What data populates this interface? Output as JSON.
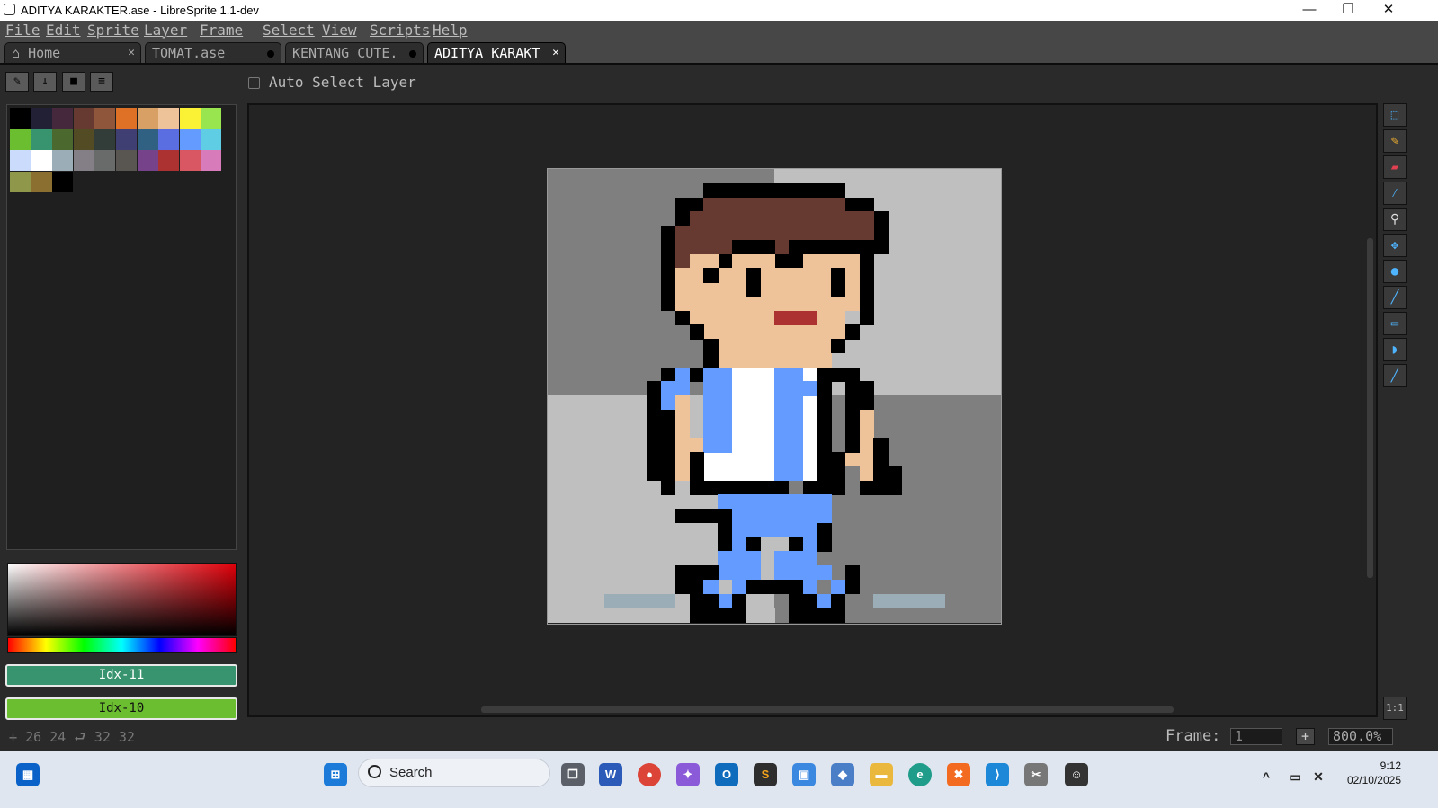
{
  "window": {
    "title": "ADITYA KARAKTER.ase - LibreSprite 1.1-dev"
  },
  "menu": [
    "File",
    "Edit",
    "Sprite",
    "Layer",
    "Frame",
    "Select",
    "View",
    "Scripts",
    "Help"
  ],
  "tabs": [
    {
      "label": "Home",
      "state": "close"
    },
    {
      "label": "TOMAT.ase",
      "state": "modified"
    },
    {
      "label": "KENTANG CUTE.",
      "state": "modified"
    },
    {
      "label": "ADITYA KARAKT",
      "state": "active"
    }
  ],
  "palette_buttons": [
    "pencil-icon",
    "arrow-down-icon",
    "square-icon",
    "menu-icon"
  ],
  "toolbar": {
    "auto_select_layer": "Auto Select Layer"
  },
  "palette": [
    "#000000",
    "#222034",
    "#45283c",
    "#663931",
    "#8f563b",
    "#df7126",
    "#d9a066",
    "#eec39a",
    "#fbf236",
    "#99e550",
    "#6abe30",
    "#37946e",
    "#4b692f",
    "#524b24",
    "#323c39",
    "#3f3f74",
    "#306082",
    "#5b6ee1",
    "#639bff",
    "#5fcde4",
    "#cbdbfc",
    "#ffffff",
    "#9badb7",
    "#847e87",
    "#696a6a",
    "#595652",
    "#76428a",
    "#ac3232",
    "#d95763",
    "#d77bba",
    "#8f974a",
    "#8a6f30",
    "#000000"
  ],
  "colors": {
    "foreground": {
      "label": "Idx-11",
      "hex": "#37946e"
    },
    "background": {
      "label": "Idx-10",
      "hex": "#6abe30"
    }
  },
  "status": {
    "cursor": "26 24",
    "size": "32 32"
  },
  "frame": {
    "label": "Frame:",
    "value": "1",
    "zoom": "800.0%"
  },
  "right_tools": [
    "rectangular-marquee-icon",
    "pencil-icon",
    "eraser-icon",
    "eyedropper-icon",
    "zoom-icon",
    "move-icon",
    "paint-bucket-icon",
    "line-icon",
    "rectangle-icon",
    "contour-icon",
    "blur-icon"
  ],
  "taskbar": {
    "search_placeholder": "Search",
    "time": "9:12",
    "date": "02/10/2025"
  }
}
